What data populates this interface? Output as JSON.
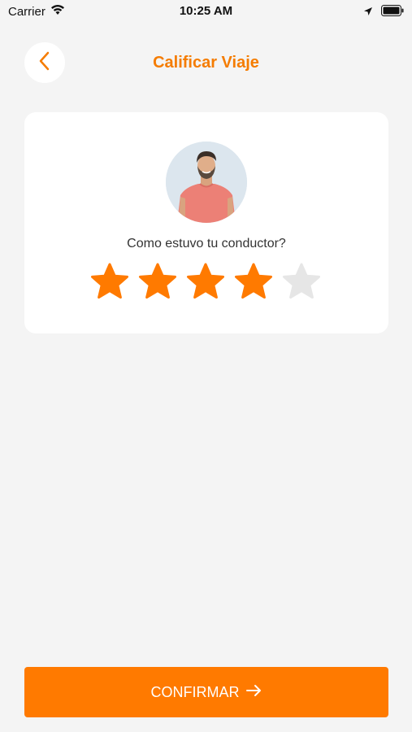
{
  "status_bar": {
    "carrier": "Carrier",
    "time": "10:25 AM",
    "icons": [
      "wifi-icon",
      "location-arrow-icon",
      "battery-icon"
    ]
  },
  "header": {
    "title": "Calificar Viaje",
    "back_icon": "chevron-left-icon"
  },
  "card": {
    "question": "Como estuvo tu conductor?",
    "rating": 4,
    "max_rating": 5
  },
  "confirm": {
    "label": "CONFIRMAR",
    "icon": "arrow-right-icon"
  },
  "colors": {
    "accent": "#ff7a00",
    "title": "#f57c00",
    "star_empty": "#e6e6e6",
    "background": "#f4f4f4",
    "card": "#ffffff"
  }
}
